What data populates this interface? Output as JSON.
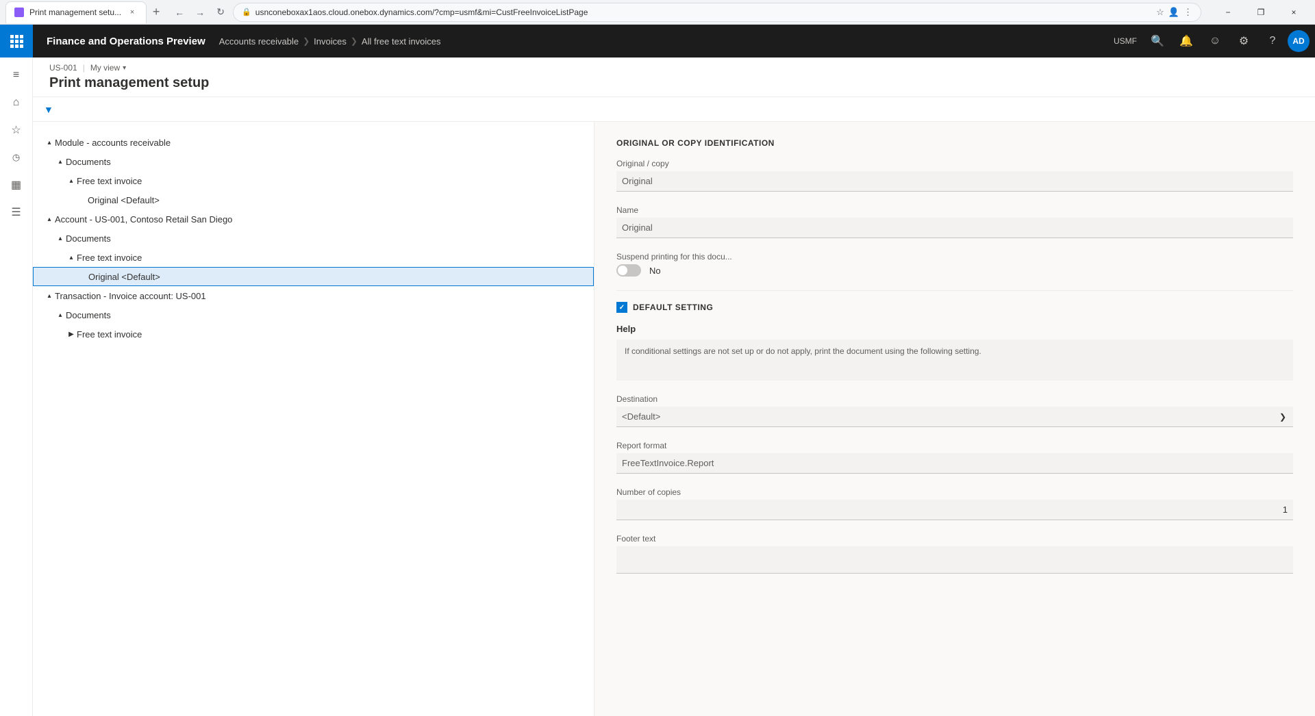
{
  "browser": {
    "tab_title": "Print management setu...",
    "url": "usnconeboxax1aos.cloud.onebox.dynamics.com/?cmp=usmf&mi=CustFreeInvoiceListPage",
    "new_tab_label": "+",
    "close_label": "×",
    "minimize_label": "−",
    "restore_label": "❐",
    "back_label": "←",
    "forward_label": "→",
    "refresh_label": "↻",
    "lock_icon": "🔒"
  },
  "topnav": {
    "app_title": "Finance and Operations Preview",
    "breadcrumb": [
      {
        "label": "Accounts receivable"
      },
      {
        "label": "Invoices"
      },
      {
        "label": "All free text invoices"
      }
    ],
    "usmf": "USMF",
    "user_initials": "AD"
  },
  "page": {
    "entity": "US-001",
    "view": "My view",
    "title": "Print management setup"
  },
  "tree": {
    "items": [
      {
        "level": 1,
        "label": "Module - accounts receivable",
        "expand": "▴",
        "indent": "indent-1"
      },
      {
        "level": 2,
        "label": "Documents",
        "expand": "▴",
        "indent": "indent-2"
      },
      {
        "level": 3,
        "label": "Free text invoice",
        "expand": "▴",
        "indent": "indent-3"
      },
      {
        "level": 4,
        "label": "Original <Default>",
        "expand": "",
        "indent": "indent-4"
      },
      {
        "level": 1,
        "label": "Account - US-001, Contoso Retail San Diego",
        "expand": "▴",
        "indent": "indent-1"
      },
      {
        "level": 2,
        "label": "Documents",
        "expand": "▴",
        "indent": "indent-2"
      },
      {
        "level": 3,
        "label": "Free text invoice",
        "expand": "▴",
        "indent": "indent-3"
      },
      {
        "level": 4,
        "label": "Original <Default>",
        "expand": "",
        "indent": "indent-4",
        "selected": true
      },
      {
        "level": 1,
        "label": "Transaction - Invoice account: US-001",
        "expand": "▴",
        "indent": "indent-1"
      },
      {
        "level": 2,
        "label": "Documents",
        "expand": "▴",
        "indent": "indent-2"
      },
      {
        "level": 3,
        "label": "Free text invoice",
        "expand": "▶",
        "indent": "indent-3"
      }
    ]
  },
  "right_panel": {
    "section_id_title": "ORIGINAL OR COPY IDENTIFICATION",
    "original_copy_label": "Original / copy",
    "original_copy_value": "Original",
    "name_label": "Name",
    "name_value": "Original",
    "suspend_label": "Suspend printing for this docu...",
    "suspend_toggle": "No",
    "default_setting_title": "DEFAULT SETTING",
    "help_heading": "Help",
    "help_text": "If conditional settings are not set up or do not apply, print the document using the following setting.",
    "destination_label": "Destination",
    "destination_value": "<Default>",
    "report_format_label": "Report format",
    "report_format_value": "FreeTextInvoice.Report",
    "copies_label": "Number of copies",
    "copies_value": "1",
    "footer_text_label": "Footer text"
  },
  "sidebar": {
    "icons": [
      {
        "name": "hamburger-icon",
        "symbol": "≡"
      },
      {
        "name": "home-icon",
        "symbol": "⌂"
      },
      {
        "name": "star-icon",
        "symbol": "☆"
      },
      {
        "name": "clock-icon",
        "symbol": "○"
      },
      {
        "name": "calendar-icon",
        "symbol": "▦"
      },
      {
        "name": "list-icon",
        "symbol": "☰"
      }
    ]
  }
}
